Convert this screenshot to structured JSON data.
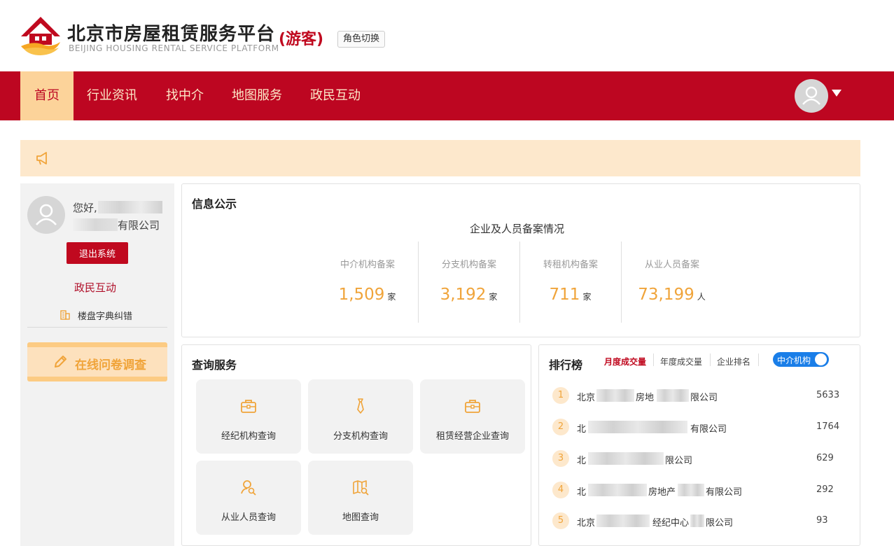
{
  "header": {
    "brand_cn": "北京市房屋租赁服务平台",
    "brand_en": "BEIJING HOUSING RENTAL SERVICE PLATFORM",
    "role_tag": "(游客)",
    "role_switch": "角色切换",
    "logo_icon": "house-hands-logo-icon"
  },
  "nav": {
    "items": [
      {
        "label": "首页",
        "active": true
      },
      {
        "label": "行业资讯",
        "active": false
      },
      {
        "label": "找中介",
        "active": false
      },
      {
        "label": "地图服务",
        "active": false
      },
      {
        "label": "政民互动",
        "active": false
      }
    ],
    "avatar_icon": "user-avatar-icon",
    "caret_icon": "caret-down-icon"
  },
  "notice": {
    "icon": "megaphone-icon"
  },
  "user": {
    "greeting": "您好,",
    "company_suffix": "有限公司",
    "logout": "退出系统",
    "gov_link": "政民互动",
    "dict_link": "楼盘字典纠错",
    "survey": "在线问卷调查"
  },
  "info": {
    "title": "信息公示",
    "stats_title": "企业及人员备案情况",
    "stats": [
      {
        "label": "中介机构备案",
        "value": "1,509",
        "unit": "家"
      },
      {
        "label": "分支机构备案",
        "value": "3,192",
        "unit": "家"
      },
      {
        "label": "转租机构备案",
        "value": "711",
        "unit": "家"
      },
      {
        "label": "从业人员备案",
        "value": "73,199",
        "unit": "人"
      }
    ]
  },
  "query": {
    "title": "查询服务",
    "tiles": [
      {
        "label": "经纪机构查询",
        "icon": "briefcase-icon"
      },
      {
        "label": "分支机构查询",
        "icon": "tie-icon"
      },
      {
        "label": "租赁经营企业查询",
        "icon": "briefcase-icon"
      },
      {
        "label": "从业人员查询",
        "icon": "person-search-icon"
      },
      {
        "label": "地图查询",
        "icon": "map-search-icon"
      }
    ]
  },
  "rank": {
    "title": "排行榜",
    "tabs": [
      {
        "label": "月度成交量",
        "active": true
      },
      {
        "label": "年度成交量",
        "active": false
      },
      {
        "label": "企业排名",
        "active": false
      }
    ],
    "toggle_label": "中介机构",
    "rows": [
      {
        "rank": "1",
        "name_start": "北京",
        "name_mid": "房地",
        "name_end": "限公司",
        "value": "5633"
      },
      {
        "rank": "2",
        "name_start": "北",
        "name_mid": "",
        "name_end": "有限公司",
        "value": "1764"
      },
      {
        "rank": "3",
        "name_start": "北",
        "name_mid": "",
        "name_end": "限公司",
        "value": "629"
      },
      {
        "rank": "4",
        "name_start": "北",
        "name_mid": "房地产",
        "name_end": "有限公司",
        "value": "292"
      },
      {
        "rank": "5",
        "name_start": "北京",
        "name_mid": "经纪中心",
        "name_end": "限公司",
        "value": "93"
      }
    ]
  },
  "colors": {
    "brand_red": "#bd0621",
    "accent_orange": "#f0a43a",
    "toggle_blue": "#1a7ee8",
    "notice_bg": "#fde8cc"
  }
}
